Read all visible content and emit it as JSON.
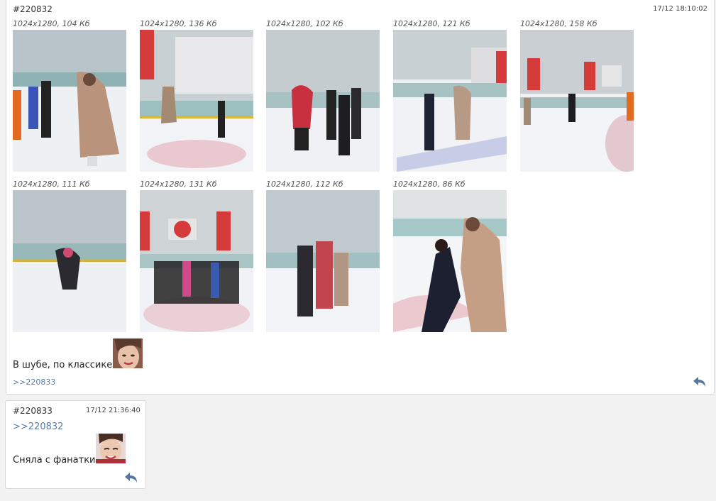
{
  "post1": {
    "id": "#220832",
    "date": "17/12 18:10:02",
    "thumbs": [
      {
        "meta": "1024x1280, 104 Кб"
      },
      {
        "meta": "1024x1280, 136 Кб"
      },
      {
        "meta": "1024x1280, 102 Кб"
      },
      {
        "meta": "1024x1280, 121 Кб"
      },
      {
        "meta": "1024x1280, 158 Кб"
      },
      {
        "meta": "1024x1280, 111 Кб"
      },
      {
        "meta": "1024x1280, 131 Кб"
      },
      {
        "meta": "1024x1280, 112 Кб"
      },
      {
        "meta": "1024x1280, 86 Кб"
      }
    ],
    "text": "В шубе, по классике",
    "reply_ref": ">>220833"
  },
  "post2": {
    "id": "#220833",
    "date": "17/12 21:36:40",
    "quote": ">>220832",
    "text": "Сняла с фанатки"
  },
  "colors": {
    "link": "#5a7ea8",
    "reply_icon": "#5577a0",
    "page_bg": "#f2f2f2"
  },
  "icons": {
    "reply": "reply-arrow-icon",
    "emoji": "face-sticker-icon"
  }
}
